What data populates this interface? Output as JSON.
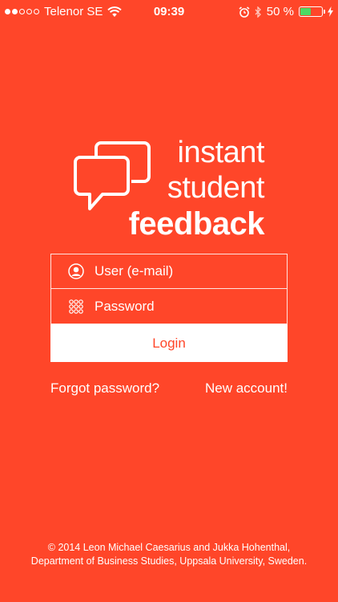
{
  "status_bar": {
    "carrier": "Telenor SE",
    "time": "09:39",
    "battery_percent": "50 %",
    "battery_level": 0.5,
    "signal_strength": 2,
    "signal_max": 5,
    "icons": [
      "wifi-icon",
      "alarm-icon",
      "bluetooth-icon",
      "battery-icon",
      "charging-icon"
    ]
  },
  "logo": {
    "line1": "instant",
    "line2": "student",
    "line3": "feedback",
    "icon": "speech-bubbles-icon"
  },
  "form": {
    "user_placeholder": "User (e-mail)",
    "password_placeholder": "Password",
    "login_label": "Login",
    "user_icon": "user-icon",
    "password_icon": "keypad-icon"
  },
  "links": {
    "forgot_password": "Forgot password?",
    "new_account": "New account!"
  },
  "footer": {
    "line1": "© 2014 Leon Michael Caesarius and Jukka Hohenthal,",
    "line2": "Department of Business Studies, Uppsala University, Sweden."
  },
  "colors": {
    "background": "#FF4629",
    "text": "#FFFFFF",
    "battery": "#4CD964"
  }
}
